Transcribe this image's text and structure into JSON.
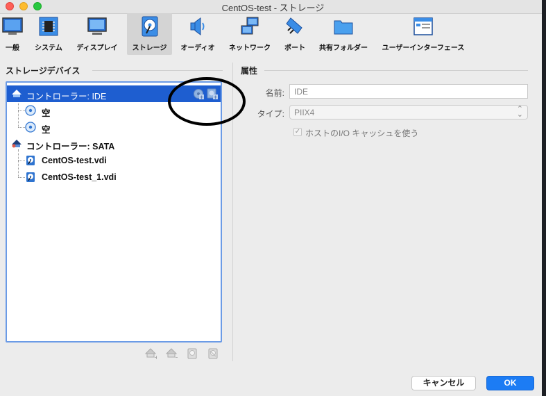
{
  "window": {
    "title": "CentOS-test - ストレージ"
  },
  "toolbar": {
    "items": [
      {
        "label": "一般",
        "icon": "general-icon"
      },
      {
        "label": "システム",
        "icon": "system-chip-icon"
      },
      {
        "label": "ディスプレイ",
        "icon": "display-monitor-icon"
      },
      {
        "label": "ストレージ",
        "icon": "storage-disk-icon",
        "selected": true
      },
      {
        "label": "オーディオ",
        "icon": "audio-speaker-icon"
      },
      {
        "label": "ネットワーク",
        "icon": "network-icon"
      },
      {
        "label": "ポート",
        "icon": "port-plug-icon"
      },
      {
        "label": "共有フォルダー",
        "icon": "shared-folder-icon"
      },
      {
        "label": "ユーザーインターフェース",
        "icon": "user-interface-icon"
      }
    ]
  },
  "storage": {
    "title": "ストレージデバイス",
    "tree": [
      {
        "label": "コントローラー: IDE",
        "type": "controller",
        "selected": true
      },
      {
        "label": "空",
        "type": "optical"
      },
      {
        "label": "空",
        "type": "optical"
      },
      {
        "label": "コントローラー: SATA",
        "type": "controller"
      },
      {
        "label": "CentOS-test.vdi",
        "type": "disk"
      },
      {
        "label": "CentOS-test_1.vdi",
        "type": "disk"
      }
    ]
  },
  "attributes": {
    "title": "属性",
    "name_label": "名前:",
    "name_value": "IDE",
    "type_label": "タイプ:",
    "type_value": "PIIX4",
    "hostio_label": "ホストのI/O キャッシュを使う",
    "hostio_checked": true
  },
  "footer": {
    "cancel": "キャンセル",
    "ok": "OK"
  },
  "colors": {
    "selection": "#1e5ed0",
    "accent": "#1c7cf4",
    "annotation": "#000000"
  }
}
